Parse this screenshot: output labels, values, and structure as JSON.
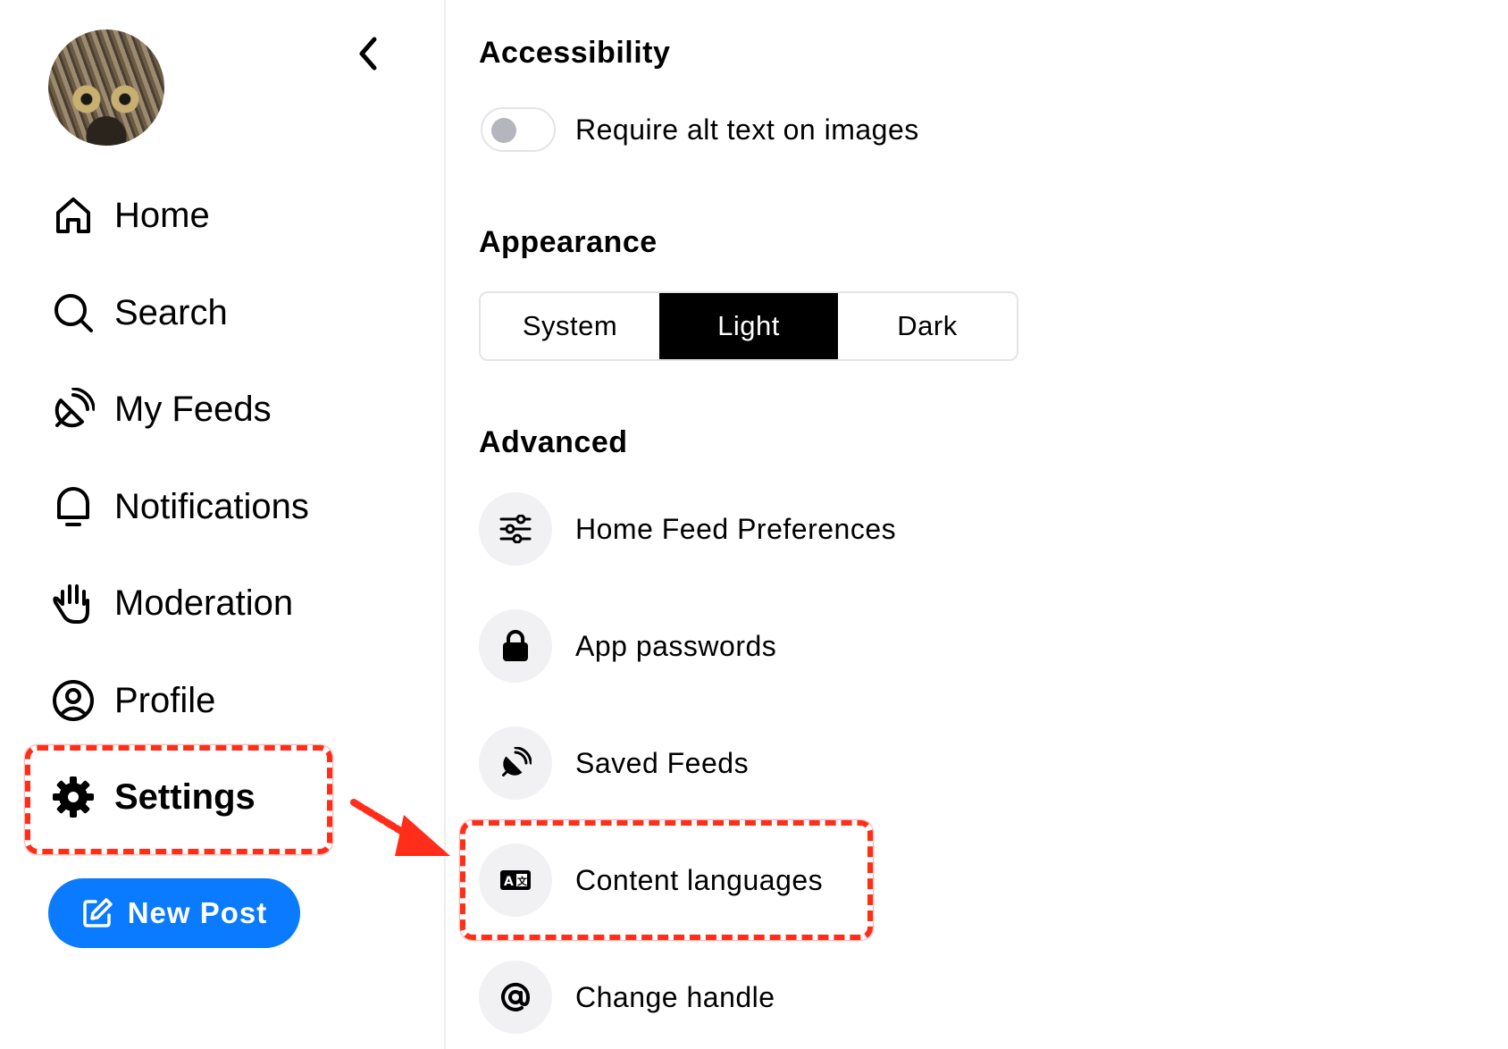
{
  "sidebar": {
    "nav": [
      {
        "label": "Home",
        "icon": "home-icon"
      },
      {
        "label": "Search",
        "icon": "search-icon"
      },
      {
        "label": "My Feeds",
        "icon": "feeds-icon"
      },
      {
        "label": "Notifications",
        "icon": "bell-icon"
      },
      {
        "label": "Moderation",
        "icon": "hand-icon"
      },
      {
        "label": "Profile",
        "icon": "profile-icon"
      },
      {
        "label": "Settings",
        "icon": "gear-icon",
        "active": true
      }
    ],
    "new_post_label": "New Post"
  },
  "settings": {
    "accessibility": {
      "title": "Accessibility",
      "alt_text_label": "Require alt text on images",
      "alt_text_enabled": false
    },
    "appearance": {
      "title": "Appearance",
      "options": [
        "System",
        "Light",
        "Dark"
      ],
      "selected": "Light"
    },
    "advanced": {
      "title": "Advanced",
      "items": [
        {
          "label": "Home Feed Preferences",
          "icon": "sliders-icon"
        },
        {
          "label": "App passwords",
          "icon": "lock-icon"
        },
        {
          "label": "Saved Feeds",
          "icon": "satellite-icon"
        },
        {
          "label": "Content languages",
          "icon": "language-icon"
        },
        {
          "label": "Change handle",
          "icon": "at-icon"
        }
      ]
    }
  },
  "colors": {
    "accent": "#0a7aff",
    "annotation": "#ff2d1a",
    "selected_segment": "#000000"
  }
}
